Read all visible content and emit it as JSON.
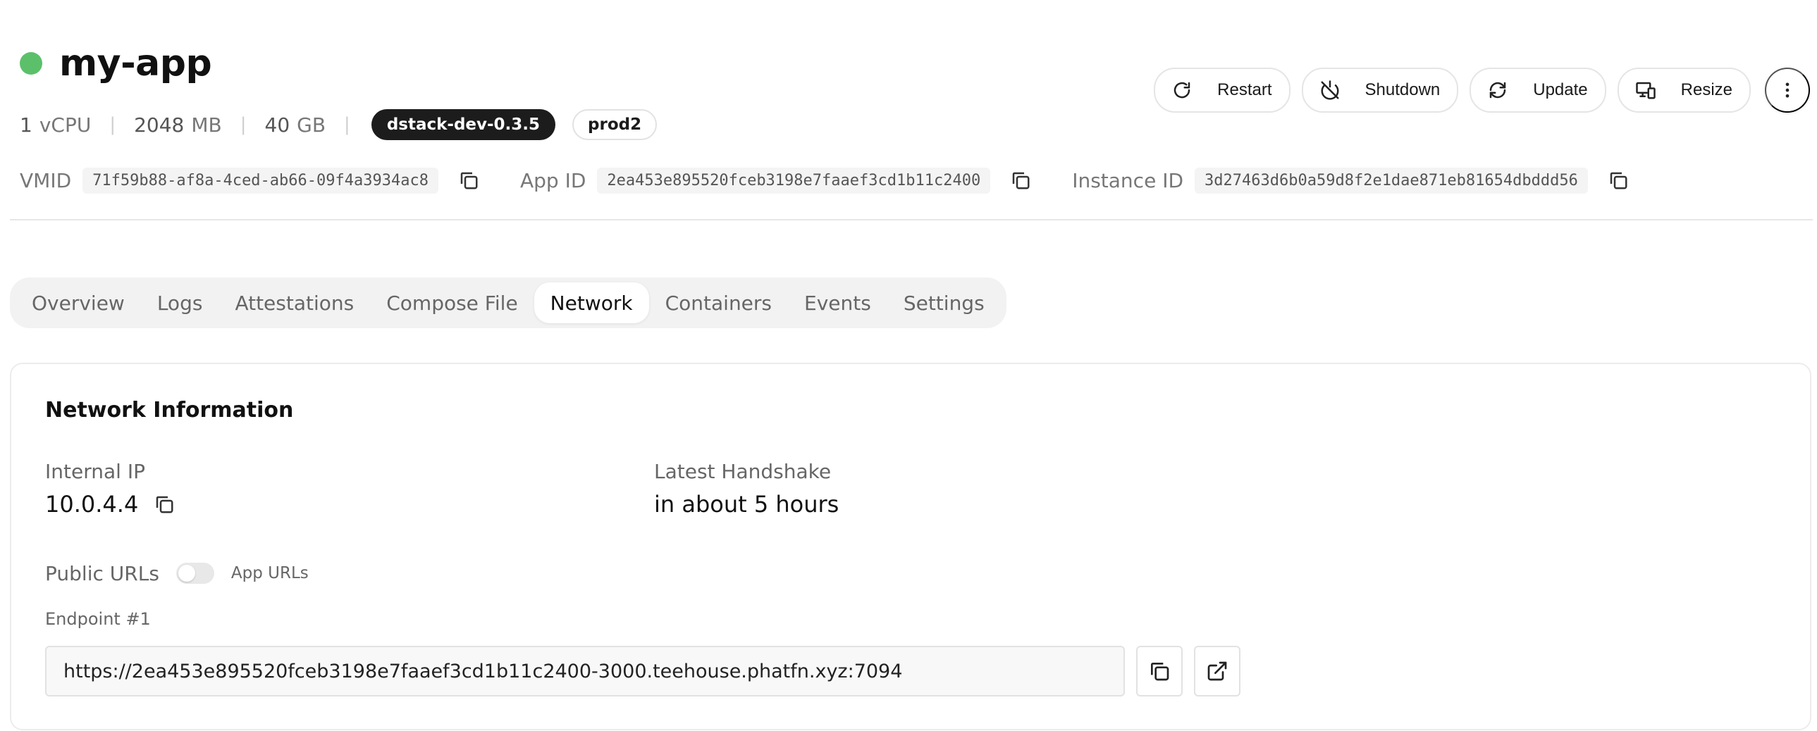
{
  "colors": {
    "status_running": "#5cc06a",
    "badge_dark": "#1c1c1c"
  },
  "header": {
    "title": "my-app",
    "status_icon": "status-dot-icon",
    "specs": {
      "vcpu_num": "1",
      "vcpu_unit": "vCPU",
      "memory_num": "2048",
      "memory_unit": "MB",
      "disk_num": "40",
      "disk_unit": "GB"
    },
    "badges": [
      "dstack-dev-0.3.5",
      "prod2"
    ],
    "actions": [
      {
        "label": "Restart",
        "icon": "restart-icon"
      },
      {
        "label": "Shutdown",
        "icon": "power-off-icon"
      },
      {
        "label": "Update",
        "icon": "refresh-icon"
      },
      {
        "label": "Resize",
        "icon": "resize-icon"
      }
    ],
    "more_icon": "more-vertical-icon",
    "ids": [
      {
        "label": "VMID",
        "value": "71f59b88-af8a-4ced-ab66-09f4a3934ac8"
      },
      {
        "label": "App ID",
        "value": "2ea453e895520fceb3198e7faaef3cd1b11c2400"
      },
      {
        "label": "Instance ID",
        "value": "3d27463d6b0a59d8f2e1dae871eb81654dbddd56"
      }
    ]
  },
  "tabs": [
    {
      "label": "Overview",
      "active": false
    },
    {
      "label": "Logs",
      "active": false
    },
    {
      "label": "Attestations",
      "active": false
    },
    {
      "label": "Compose File",
      "active": false
    },
    {
      "label": "Network",
      "active": true
    },
    {
      "label": "Containers",
      "active": false
    },
    {
      "label": "Events",
      "active": false
    },
    {
      "label": "Settings",
      "active": false
    }
  ],
  "network": {
    "title": "Network Information",
    "internal_ip_label": "Internal IP",
    "internal_ip": "10.0.4.4",
    "handshake_label": "Latest Handshake",
    "handshake": "in about 5 hours",
    "public_urls_label": "Public URLs",
    "toggle_label": "App URLs",
    "toggle_on": false,
    "endpoint_label": "Endpoint #1",
    "endpoint_url": "https://2ea453e895520fceb3198e7faaef3cd1b11c2400-3000.teehouse.phatfn.xyz:7094"
  }
}
